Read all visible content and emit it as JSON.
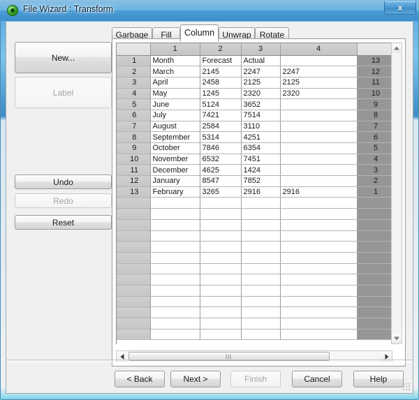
{
  "window": {
    "title": "File Wizard : Transform",
    "app_icon": "green-circle-icon",
    "close_label": "x"
  },
  "sidebar": {
    "buttons": [
      {
        "label": "New...",
        "enabled": true
      },
      {
        "label": "Label",
        "enabled": false
      },
      {
        "label": "Undo",
        "enabled": true
      },
      {
        "label": "Redo",
        "enabled": false
      },
      {
        "label": "Reset",
        "enabled": true
      }
    ]
  },
  "tabs": [
    {
      "label": "Garbage",
      "active": false
    },
    {
      "label": "Fill",
      "active": false
    },
    {
      "label": "Column",
      "active": true
    },
    {
      "label": "Unwrap",
      "active": false
    },
    {
      "label": "Rotate",
      "active": false
    }
  ],
  "grid": {
    "column_headers": [
      "1",
      "2",
      "3",
      "4"
    ],
    "rows": [
      {
        "num": "1",
        "cells": [
          "Month",
          "Forecast",
          "Actual",
          ""
        ],
        "tail": "13"
      },
      {
        "num": "2",
        "cells": [
          "March",
          "2145",
          "2247",
          "2247"
        ],
        "tail": "12"
      },
      {
        "num": "3",
        "cells": [
          "April",
          "2458",
          "2125",
          "2125"
        ],
        "tail": "11"
      },
      {
        "num": "4",
        "cells": [
          "May",
          "1245",
          "2320",
          "2320"
        ],
        "tail": "10"
      },
      {
        "num": "5",
        "cells": [
          "June",
          "5124",
          "3652",
          ""
        ],
        "tail": "9"
      },
      {
        "num": "6",
        "cells": [
          "July",
          "7421",
          "7514",
          ""
        ],
        "tail": "8"
      },
      {
        "num": "7",
        "cells": [
          "August",
          "2584",
          "3110",
          ""
        ],
        "tail": "7"
      },
      {
        "num": "8",
        "cells": [
          "September",
          "5314",
          "4251",
          ""
        ],
        "tail": "6"
      },
      {
        "num": "9",
        "cells": [
          "October",
          "7846",
          "6354",
          ""
        ],
        "tail": "5"
      },
      {
        "num": "10",
        "cells": [
          "November",
          "6532",
          "7451",
          ""
        ],
        "tail": "4"
      },
      {
        "num": "11",
        "cells": [
          "December",
          "4625",
          "1424",
          ""
        ],
        "tail": "3"
      },
      {
        "num": "12",
        "cells": [
          "January",
          "8547",
          "7852",
          ""
        ],
        "tail": "2"
      },
      {
        "num": "13",
        "cells": [
          "February",
          "3265",
          "2916",
          "2916"
        ],
        "tail": "1"
      },
      {
        "num": "",
        "cells": [
          "",
          "",
          "",
          ""
        ],
        "tail": ""
      },
      {
        "num": "",
        "cells": [
          "",
          "",
          "",
          ""
        ],
        "tail": ""
      },
      {
        "num": "",
        "cells": [
          "",
          "",
          "",
          ""
        ],
        "tail": ""
      },
      {
        "num": "",
        "cells": [
          "",
          "",
          "",
          ""
        ],
        "tail": ""
      },
      {
        "num": "",
        "cells": [
          "",
          "",
          "",
          ""
        ],
        "tail": ""
      },
      {
        "num": "",
        "cells": [
          "",
          "",
          "",
          ""
        ],
        "tail": ""
      },
      {
        "num": "",
        "cells": [
          "",
          "",
          "",
          ""
        ],
        "tail": ""
      },
      {
        "num": "",
        "cells": [
          "",
          "",
          "",
          ""
        ],
        "tail": ""
      },
      {
        "num": "",
        "cells": [
          "",
          "",
          "",
          ""
        ],
        "tail": ""
      },
      {
        "num": "",
        "cells": [
          "",
          "",
          "",
          ""
        ],
        "tail": ""
      },
      {
        "num": "",
        "cells": [
          "",
          "",
          "",
          ""
        ],
        "tail": ""
      },
      {
        "num": "",
        "cells": [
          "",
          "",
          "",
          ""
        ],
        "tail": ""
      },
      {
        "num": "",
        "cells": [
          "",
          "",
          "",
          ""
        ],
        "tail": ""
      }
    ]
  },
  "scrollbars": {
    "vertical": {
      "up_icon": "arrow-up-icon",
      "down_icon": "arrow-down-icon"
    },
    "horizontal": {
      "left_icon": "arrow-left-icon",
      "right_icon": "arrow-right-icon"
    }
  },
  "footer": {
    "buttons": [
      {
        "label": "< Back",
        "enabled": true
      },
      {
        "label": "Next >",
        "enabled": true
      },
      {
        "label": "Finish",
        "enabled": false
      },
      {
        "label": "Cancel",
        "enabled": true
      },
      {
        "label": "Help",
        "enabled": true
      }
    ]
  },
  "colors": {
    "accent": "#4fa3da",
    "dialog_bg": "#f0f0f0",
    "grid_header": "#c8c8c8",
    "grid_tail": "#969696"
  }
}
